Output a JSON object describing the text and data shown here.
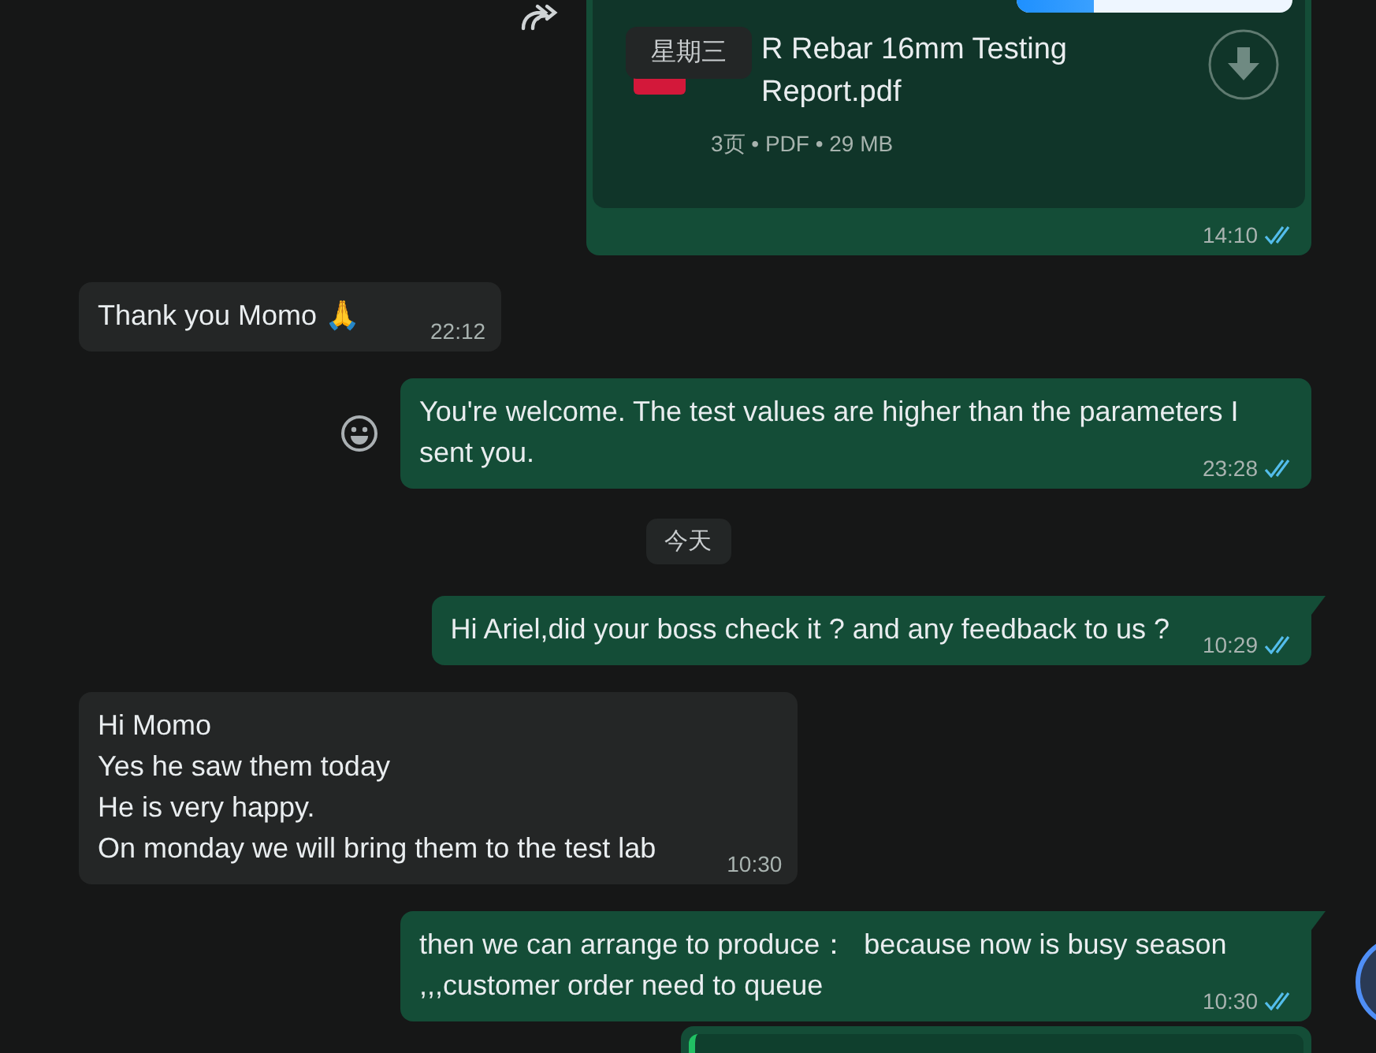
{
  "top_bar": {
    "level": 0.28
  },
  "date_sticker": "星期三",
  "messages": [
    {
      "kind": "document",
      "outgoing": true,
      "forward_button": true,
      "document": {
        "name": "R Rebar 16mm Testing Report.pdf",
        "info": "3页 • PDF • 29 MB"
      },
      "time": "14:10",
      "read": true
    },
    {
      "kind": "text",
      "outgoing": false,
      "text": "Thank you Momo 🙏",
      "time": "22:12"
    },
    {
      "kind": "text",
      "outgoing": true,
      "emoji_button": true,
      "text": "You're welcome. The test values are higher than the parameters I sent you.",
      "time": "23:28",
      "read": true
    },
    {
      "kind": "date",
      "text": "今天"
    },
    {
      "kind": "text",
      "outgoing": true,
      "tail": true,
      "text": "Hi Ariel,did your boss check it ? and any feedback to us ?",
      "time": "10:29",
      "read": true
    },
    {
      "kind": "text",
      "outgoing": false,
      "text": "Hi Momo\nYes he saw them today\nHe is very happy.\nOn monday we will bring them to the test lab",
      "time": "10:30"
    },
    {
      "kind": "text",
      "outgoing": true,
      "tail": true,
      "text": "then we can arrange to produce：  because now is busy season ,,,customer order need to queue",
      "time": "10:30",
      "read": true
    },
    {
      "kind": "partial",
      "outgoing": true
    }
  ]
}
